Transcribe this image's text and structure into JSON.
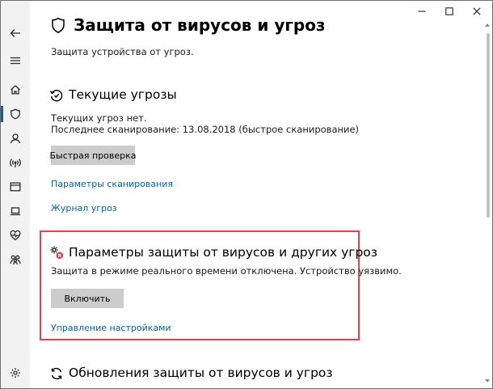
{
  "window": {
    "controls": {
      "minimize": "minimize",
      "maximize": "maximize",
      "close": "close"
    }
  },
  "nav": {
    "items": [
      {
        "icon": "back-arrow-icon"
      },
      {
        "icon": "hamburger-menu-icon"
      },
      {
        "icon": "home-icon"
      },
      {
        "icon": "shield-icon",
        "active": true
      },
      {
        "icon": "account-icon"
      },
      {
        "icon": "firewall-network-icon"
      },
      {
        "icon": "app-browser-control-icon"
      },
      {
        "icon": "device-security-icon"
      },
      {
        "icon": "device-health-icon"
      },
      {
        "icon": "family-options-icon"
      },
      {
        "icon": "settings-gear-icon"
      }
    ],
    "accent": "#0063b1"
  },
  "page": {
    "title": "Защита от вирусов и угроз",
    "subtitle": "Защита устройства от угроз."
  },
  "current_threats": {
    "title": "Текущие угрозы",
    "status": "Текущих угроз нет.",
    "last_scan": "Последнее сканирование: 13.08.2018 (быстрое сканирование)",
    "quick_scan_button": "Быстрая проверка",
    "scan_options_link": "Параметры сканирования",
    "threat_history_link": "Журнал угроз"
  },
  "protection_settings": {
    "title": "Параметры защиты от вирусов и других угроз",
    "status": "Защита в режиме реального времени отключена. Устройство уязвимо.",
    "enable_button": "Включить",
    "manage_settings_link": "Управление настройками",
    "highlight_color": "#e0454b"
  },
  "updates": {
    "title": "Обновления защиты от вирусов и угроз"
  },
  "colors": {
    "link": "#0063b1",
    "button_bg": "#cccccc",
    "rail_bg": "#f2f2f2"
  }
}
